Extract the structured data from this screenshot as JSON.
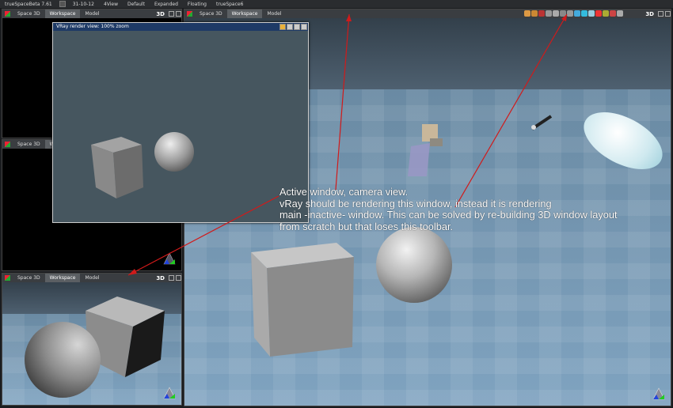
{
  "titlebar": {
    "app_title": "trueSpaceBeta 7.61",
    "date": "31-10-12",
    "layouts": [
      "4View",
      "Default",
      "Expanded",
      "Floating",
      "trueSpace6"
    ]
  },
  "views": {
    "top_left": {
      "tab_space": "Space 3D",
      "tab_workspace": "Workspace",
      "tab_model": "Model",
      "badge": "3D"
    },
    "mid_left": {
      "tab_space": "Space 3D",
      "tab_workspace": "Wo"
    },
    "bottom_left": {
      "tab_space": "Space 3D",
      "tab_workspace": "Workspace",
      "tab_model": "Model",
      "badge": "3D"
    },
    "main": {
      "tab_space": "Space 3D",
      "tab_workspace": "Workspace",
      "tab_model": "Model",
      "badge": "3D"
    }
  },
  "render_window": {
    "title": "VRay render view: 100% zoom"
  },
  "annotation": {
    "lines": [
      "Active window, camera view.",
      "vRay should be rendering this window, instead it is rendering",
      "main -inactive- window. This can be solved by re-building 3D window layout",
      "from scratch but that loses this toolbar."
    ],
    "arrow_color": "#d11a1a"
  },
  "colors": {
    "accent": "#1e3a66",
    "floor": "#7fa3c0"
  }
}
